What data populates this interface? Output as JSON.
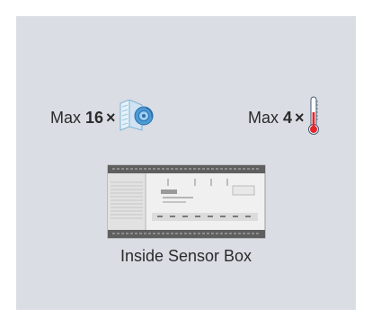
{
  "limits": [
    {
      "prefix": "Max",
      "count": "16",
      "times": "×",
      "icon": "ventilation-sensor-icon"
    },
    {
      "prefix": "Max",
      "count": "4",
      "times": "×",
      "icon": "thermometer-icon"
    }
  ],
  "device": {
    "icon": "din-rail-controller-icon"
  },
  "caption": "Inside Sensor Box",
  "colors": {
    "panel": "#dadde4",
    "text": "#2b2b2b",
    "accent": "#3a8fd0"
  }
}
